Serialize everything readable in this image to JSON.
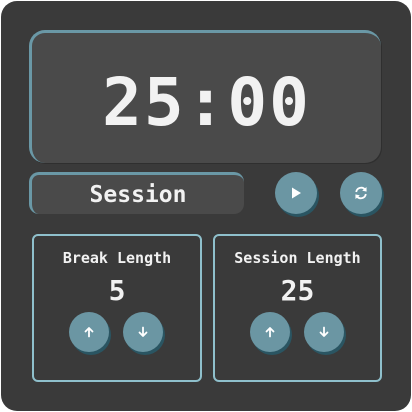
{
  "timer": {
    "time": "25:00",
    "label": "Session"
  },
  "controls": {
    "play_icon": "play-icon",
    "reset_icon": "refresh-icon"
  },
  "break_length": {
    "title": "Break Length",
    "value": "5",
    "increment_icon": "arrow-up-icon",
    "decrement_icon": "arrow-down-icon"
  },
  "session_length": {
    "title": "Session Length",
    "value": "25",
    "increment_icon": "arrow-up-icon",
    "decrement_icon": "arrow-down-icon"
  },
  "colors": {
    "background": "#3a3a3a",
    "panel": "#4a4a4a",
    "accent": "#6b96a3",
    "border": "#8fc0cc",
    "text": "#f2f2f2"
  }
}
